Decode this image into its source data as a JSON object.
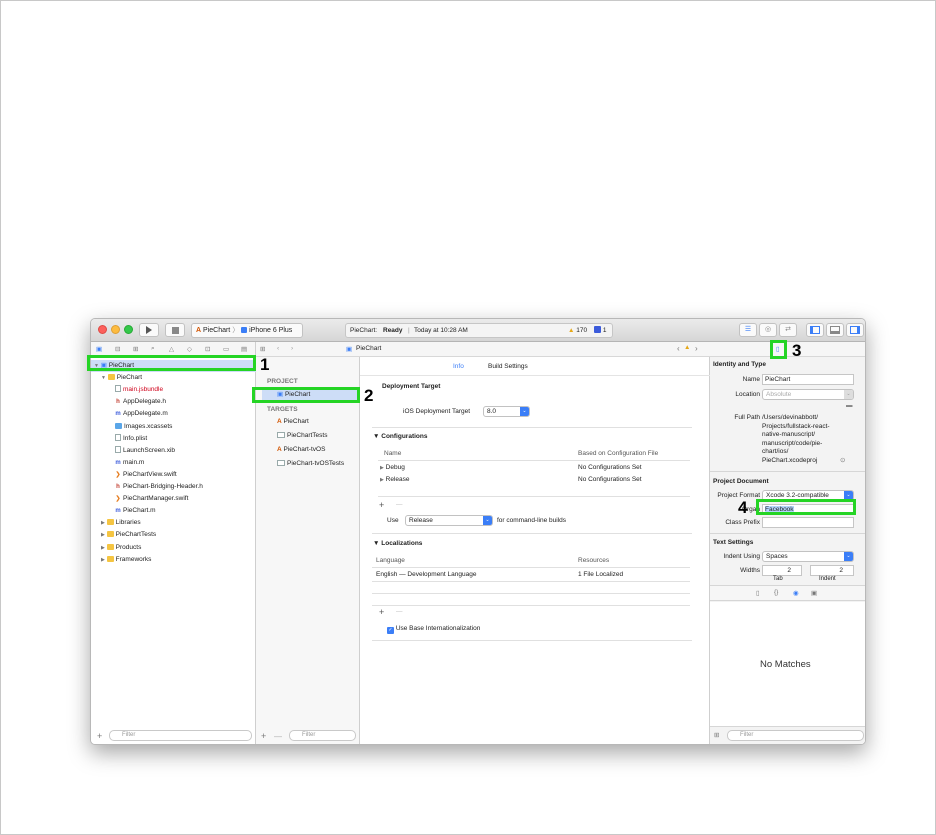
{
  "toolbar": {
    "scheme_target": "PieChart",
    "scheme_device": "iPhone 6 Plus",
    "activity_app": "PieChart:",
    "activity_status": "Ready",
    "activity_separator": "|",
    "activity_time": "Today at 10:28 AM",
    "warning_count": "170",
    "issue_count": "1"
  },
  "navigator": {
    "items": [
      {
        "label": "PieChart",
        "level": 0,
        "type": "project",
        "expanded": true
      },
      {
        "label": "PieChart",
        "level": 1,
        "type": "folder",
        "expanded": true
      },
      {
        "label": "main.jsbundle",
        "level": 2,
        "type": "file",
        "color": "#d0021b"
      },
      {
        "label": "AppDelegate.h",
        "level": 2,
        "type": "h"
      },
      {
        "label": "AppDelegate.m",
        "level": 2,
        "type": "m"
      },
      {
        "label": "Images.xcassets",
        "level": 2,
        "type": "assets"
      },
      {
        "label": "Info.plist",
        "level": 2,
        "type": "file"
      },
      {
        "label": "LaunchScreen.xib",
        "level": 2,
        "type": "file"
      },
      {
        "label": "main.m",
        "level": 2,
        "type": "m"
      },
      {
        "label": "PieChartView.swift",
        "level": 2,
        "type": "swift"
      },
      {
        "label": "PieChart-Bridging-Header.h",
        "level": 2,
        "type": "h"
      },
      {
        "label": "PieChartManager.swift",
        "level": 2,
        "type": "swift"
      },
      {
        "label": "PieChart.m",
        "level": 2,
        "type": "m"
      },
      {
        "label": "Libraries",
        "level": 1,
        "type": "folder",
        "expanded": false
      },
      {
        "label": "PieChartTests",
        "level": 1,
        "type": "folder",
        "expanded": false
      },
      {
        "label": "Products",
        "level": 1,
        "type": "folder",
        "expanded": false
      },
      {
        "label": "Frameworks",
        "level": 1,
        "type": "folder",
        "expanded": false
      }
    ],
    "filter_placeholder": "Filter"
  },
  "jumpbar": {
    "crumb": "PieChart"
  },
  "targets_pane": {
    "project_header": "PROJECT",
    "project_item": "PieChart",
    "targets_header": "TARGETS",
    "targets": [
      "PieChart",
      "PieChartTests",
      "PieChart-tvOS",
      "PieChart-tvOSTests"
    ],
    "filter_placeholder": "Filter"
  },
  "editor": {
    "tabs": [
      "Info",
      "Build Settings"
    ],
    "deployment_title": "Deployment Target",
    "deployment_label": "iOS Deployment Target",
    "deployment_value": "8.0",
    "configurations_title": "Configurations",
    "config_col_name": "Name",
    "config_col_based": "Based on Configuration File",
    "configs": [
      {
        "name": "Debug",
        "based": "No Configurations Set"
      },
      {
        "name": "Release",
        "based": "No Configurations Set"
      }
    ],
    "use_label": "Use",
    "use_value": "Release",
    "use_suffix": "for command-line builds",
    "localizations_title": "Localizations",
    "loc_col_language": "Language",
    "loc_col_resources": "Resources",
    "loc_rows": [
      {
        "language": "English — Development Language",
        "resources": "1 File Localized"
      }
    ],
    "base_intl_label": "Use Base Internationalization",
    "add_symbol": "+",
    "remove_symbol": "—"
  },
  "inspector": {
    "identity_title": "Identity and Type",
    "name_label": "Name",
    "name_value": "PieChart",
    "location_label": "Location",
    "location_value": "Absolute",
    "fullpath_label": "Full Path",
    "fullpath_lines": [
      "/Users/devinabbott/",
      "Projects/fullstack-react-",
      "native-manuscript/",
      "manuscript/code/pie-",
      "chart/ios/",
      "PieChart.xcodeproj"
    ],
    "project_doc_title": "Project Document",
    "format_label": "Project Format",
    "format_value": "Xcode 3.2-compatible",
    "org_label": "Organ",
    "org_value": "Facebook",
    "prefix_label": "Class Prefix",
    "text_settings_title": "Text Settings",
    "indent_label": "Indent Using",
    "indent_value": "Spaces",
    "widths_label": "Widths",
    "tab_value": "2",
    "indent_width_value": "2",
    "tab_caption": "Tab",
    "indent_caption": "Indent",
    "library_empty": "No Matches",
    "filter_placeholder": "Filter"
  },
  "annotations": {
    "one": "1",
    "two": "2",
    "three": "3",
    "four": "4",
    "color": "#25d425"
  }
}
